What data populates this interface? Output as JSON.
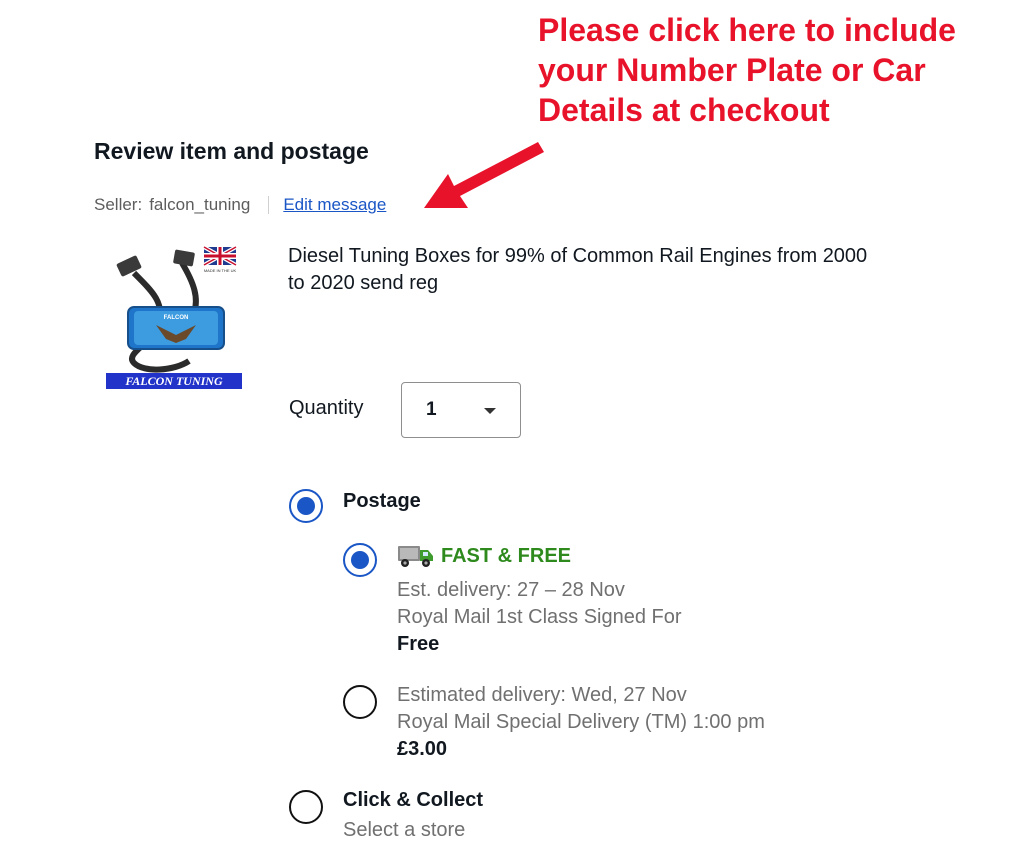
{
  "annotation": {
    "line1": "Please click here to include",
    "line2": "your Number Plate or Car",
    "line3": "Details at checkout"
  },
  "section_title": "Review item and postage",
  "seller": {
    "label": "Seller:",
    "name": "falcon_tuning",
    "edit_message": "Edit message"
  },
  "item": {
    "title_line1": "Diesel Tuning Boxes for 99% of Common Rail Engines from 2000",
    "title_line2": "to 2020 send reg",
    "image_brand": "FALCON TUNING"
  },
  "quantity": {
    "label": "Quantity",
    "value": "1"
  },
  "delivery": {
    "postage_label": "Postage",
    "postage_selected": true,
    "options": [
      {
        "badge": "FAST & FREE",
        "estimate": "Est. delivery: 27 – 28 Nov",
        "service": "Royal Mail 1st Class Signed For",
        "price": "Free",
        "selected": true
      },
      {
        "estimate": "Estimated delivery: Wed, 27 Nov",
        "service": "Royal Mail Special Delivery (TM) 1:00 pm",
        "price": "£3.00",
        "selected": false
      }
    ],
    "collect_label": "Click & Collect",
    "collect_sub": "Select a store",
    "collect_selected": false
  },
  "colors": {
    "annotation_red": "#e8132b",
    "link_blue": "#1a56c6",
    "fast_free_green": "#2f8a1e"
  }
}
